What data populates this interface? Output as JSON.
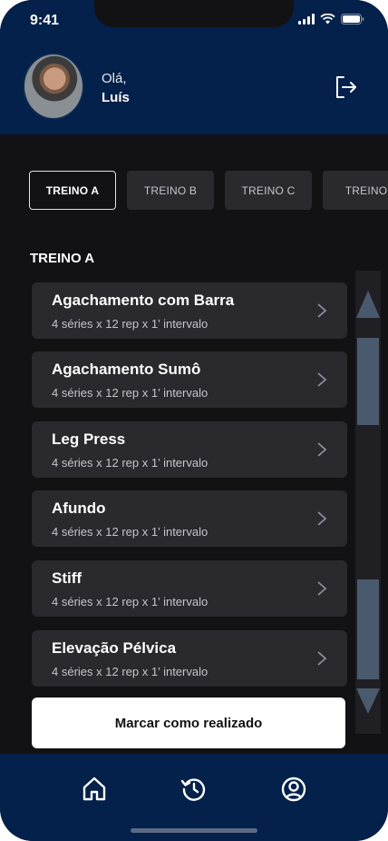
{
  "status_bar": {
    "time": "9:41"
  },
  "profile": {
    "greeting": "Olá,",
    "name": "Luís"
  },
  "icons": {
    "signal": "signal-icon",
    "wifi": "wifi-icon",
    "battery": "battery-icon",
    "logout": "logout-icon",
    "chevron": "chevron-right-icon",
    "home": "home-icon",
    "history": "history-icon",
    "profile": "user-circle-icon"
  },
  "tabs": [
    {
      "label": "TREINO A",
      "active": true
    },
    {
      "label": "TREINO B",
      "active": false
    },
    {
      "label": "TREINO C",
      "active": false
    },
    {
      "label": "TREINO",
      "active": false
    }
  ],
  "section_title": "TREINO A",
  "exercises": [
    {
      "name": "Agachamento com Barra",
      "details": "4 séries x 12 rep x 1’ intervalo"
    },
    {
      "name": "Agachamento Sumô",
      "details": "4 séries x 12 rep x 1’ intervalo"
    },
    {
      "name": "Leg Press",
      "details": "4 séries x 12 rep x 1’ intervalo"
    },
    {
      "name": "Afundo",
      "details": "4 séries x 12 rep x 1’ intervalo"
    },
    {
      "name": "Stiff",
      "details": "4 séries x 12 rep x 1’ intervalo"
    },
    {
      "name": "Elevação Pélvica",
      "details": "4 séries x 12 rep x 1’ intervalo"
    }
  ],
  "done_button": "Marcar como realizado",
  "colors": {
    "header": "#03214a",
    "background": "#121214",
    "card": "#29292e",
    "accent": "#ffffff"
  }
}
